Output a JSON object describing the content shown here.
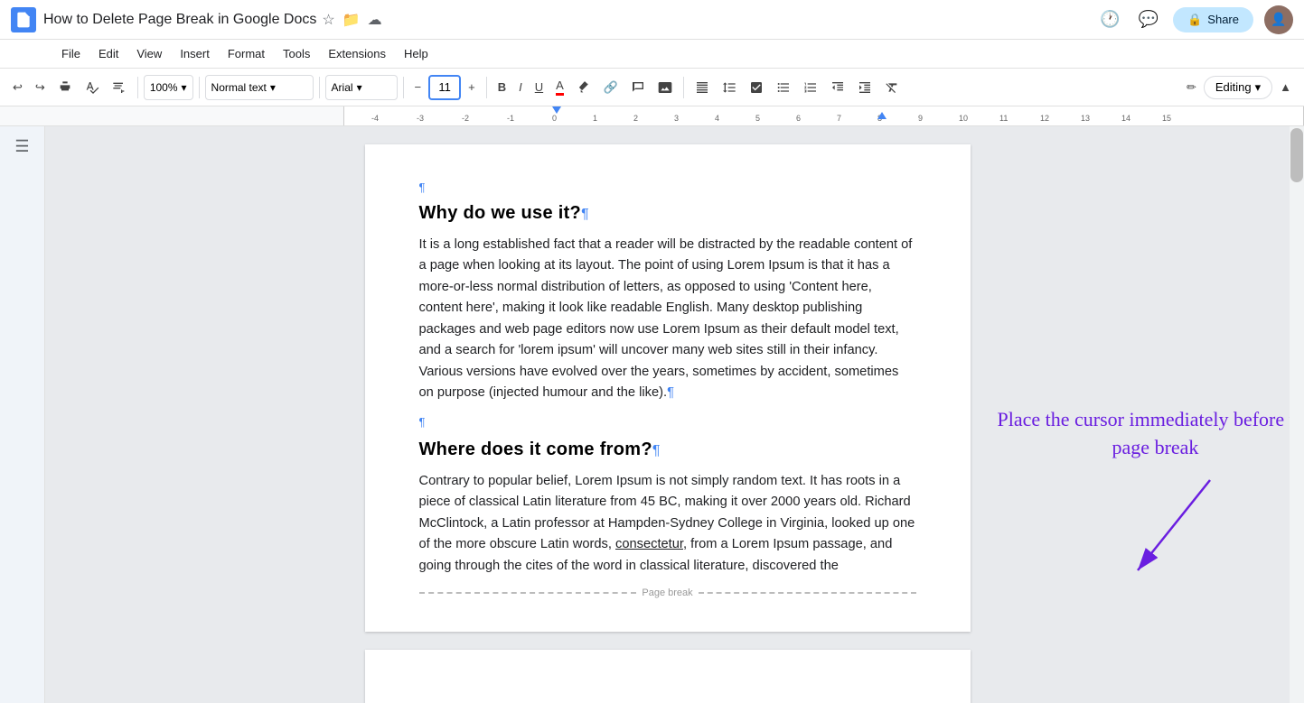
{
  "titleBar": {
    "docIcon": "📄",
    "title": "How to Delete Page Break in Google Docs",
    "titleIcons": [
      "☆",
      "📁",
      "☁"
    ],
    "rightIcons": [
      "🕐",
      "💬"
    ],
    "shareBtn": {
      "icon": "🔒",
      "label": "Share"
    }
  },
  "menuBar": {
    "items": [
      "File",
      "Edit",
      "View",
      "Insert",
      "Format",
      "Tools",
      "Extensions",
      "Help"
    ]
  },
  "toolbar": {
    "undo": "↩",
    "redo": "↪",
    "print": "🖨",
    "spellcheck": "✓",
    "paintFormat": "🖌",
    "zoom": "100%",
    "zoomArrow": "▾",
    "styleSelect": "Normal text",
    "styleArrow": "▾",
    "fontSelect": "Arial",
    "fontArrow": "▾",
    "minus": "−",
    "fontSize": "11",
    "plus": "+",
    "bold": "B",
    "italic": "I",
    "underline": "U",
    "textColor": "A",
    "highlight": "🖊",
    "link": "🔗",
    "comment": "💬",
    "image": "🖼",
    "align": "≡",
    "lineSpacing": "↕",
    "checklist": "☑",
    "bulletList": "☰",
    "numberedList": "1.",
    "indentDec": "←",
    "indentInc": "→",
    "clearFormat": "✕",
    "pencil": "✏",
    "editingMode": "Editing",
    "editingArrow": "▾",
    "collapse": "▲"
  },
  "document": {
    "heading1": "Why do we use it?",
    "para1": "It is a long established fact that a reader will be distracted by the readable content of a page when looking at its layout. The point of using Lorem Ipsum is that it has a more-or-less normal distribution of letters, as opposed to using 'Content here, content here', making it look like readable English. Many desktop publishing packages and web page editors now use Lorem Ipsum as their default model text, and a search for 'lorem ipsum' will uncover many web sites still in their infancy. Various versions have evolved over the years, sometimes by accident, sometimes on purpose (injected humour and the like).",
    "heading2": "Where does it come from?",
    "para2": "Contrary to popular belief, Lorem Ipsum is not simply random text. It has roots in a piece of classical Latin literature from 45 BC, making it over 2000 years old. Richard McClintock, a Latin professor at Hampden-Sydney College in Virginia, looked up one of the more obscure Latin words, consectetur, from a Lorem Ipsum passage, and going through the cites of the word in classical literature, discovered the",
    "pageBreakLabel": "Page break"
  },
  "annotation": {
    "text": "Place the cursor immediately before the page break"
  }
}
